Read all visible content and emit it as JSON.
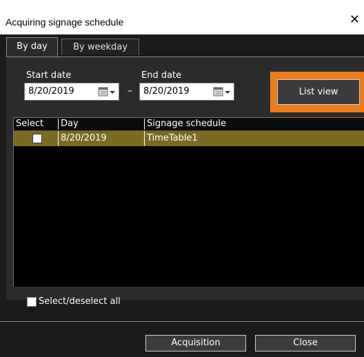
{
  "window": {
    "title": "Acquiring signage schedule",
    "close_glyph": "✕"
  },
  "tabs": [
    {
      "label": "By day",
      "active": true
    },
    {
      "label": "By weekday",
      "active": false
    }
  ],
  "date_range": {
    "start_label": "Start date",
    "start_value": "8/20/2019",
    "separator": "–",
    "end_label": "End date",
    "end_value": "8/20/2019",
    "calendar_icon": "calendar-dropdown-icon"
  },
  "list_view_button": {
    "label": "List view",
    "highlight_color": "#ef7c1a"
  },
  "table": {
    "columns": [
      "Select",
      "Day",
      "Signage schedule"
    ],
    "rows": [
      {
        "selected": false,
        "day": "8/20/2019",
        "schedule": "TimeTable1"
      }
    ],
    "row_highlight_color": "#7b6a20"
  },
  "select_all": {
    "label": "Select/deselect all",
    "checked": false
  },
  "footer": {
    "acquisition_label": "Acquisition",
    "close_label": "Close"
  }
}
